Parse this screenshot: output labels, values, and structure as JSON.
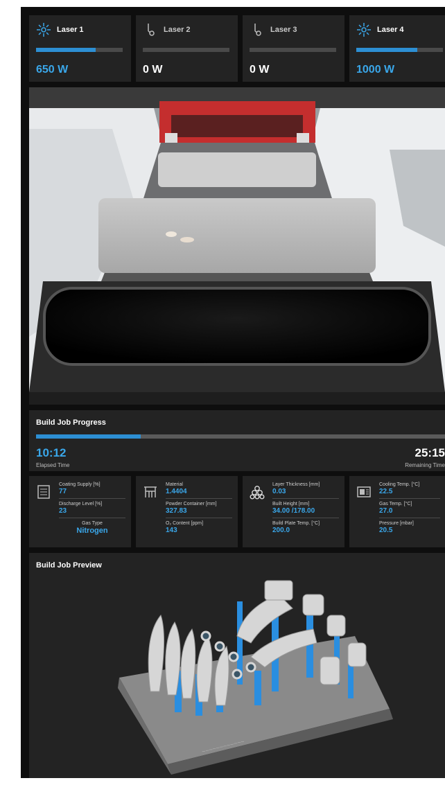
{
  "lasers": [
    {
      "name": "Laser 1",
      "value": "650 W",
      "state": "on",
      "level": 0.69
    },
    {
      "name": "Laser 2",
      "value": "0 W",
      "state": "off",
      "level": 0
    },
    {
      "name": "Laser 3",
      "value": "0 W",
      "state": "off",
      "level": 0
    },
    {
      "name": "Laser 4",
      "value": "1000 W",
      "state": "on",
      "level": 0.7
    }
  ],
  "progress": {
    "title": "Build Job Progress",
    "fraction": 0.255,
    "elapsed": "10:12",
    "elapsed_label": "Elapsed Time",
    "remaining": "25:15",
    "remaining_label": "Remaining Time"
  },
  "metrics": [
    {
      "icon": "container-icon",
      "rows": [
        {
          "label": "Coating Supply [%]",
          "value": "77"
        },
        {
          "label": "Discharge Level [%]",
          "value": "23"
        },
        {
          "label": "Gas Type",
          "value": "Nitrogen"
        }
      ]
    },
    {
      "icon": "table-frame-icon",
      "rows": [
        {
          "label": "Material",
          "value": "1.4404"
        },
        {
          "label": "Powder Container [mm]",
          "value": "327.83"
        },
        {
          "label": "O₂ Content [ppm]",
          "value": "143"
        }
      ]
    },
    {
      "icon": "powder-stack-icon",
      "rows": [
        {
          "label": "Layer Thickness [mm]",
          "value": "0.03"
        },
        {
          "label": "Built Height [mm]",
          "value": "34.00 /178.00"
        },
        {
          "label": "Build Plate Temp. [°C]",
          "value": "200.0"
        }
      ]
    },
    {
      "icon": "cooling-icon",
      "rows": [
        {
          "label": "Cooling Temp. [°C]",
          "value": "22.5"
        },
        {
          "label": "Gas Temp. [°C]",
          "value": "27.0"
        },
        {
          "label": "Pressure [mbar]",
          "value": "20.5"
        }
      ]
    }
  ],
  "preview": {
    "title": "Build Job Preview"
  },
  "colors": {
    "accent": "#2d8fd3",
    "accent_text": "#3aa7ea",
    "panel": "#232323",
    "background": "#0e0e0e"
  }
}
